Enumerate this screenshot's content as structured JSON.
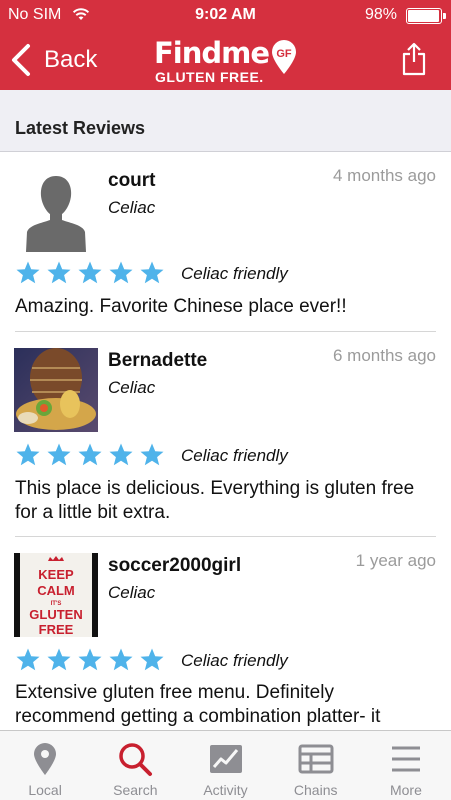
{
  "status_bar": {
    "carrier": "No SIM",
    "time": "9:02 AM",
    "battery": "98%",
    "battery_level": 0.98
  },
  "nav": {
    "back_label": "Back",
    "logo_top": "Findme",
    "logo_badge": "GF",
    "logo_bottom": "GLUTEN FREE."
  },
  "section": {
    "title": "Latest Reviews"
  },
  "reviews": [
    {
      "name": "court",
      "tag": "Celiac",
      "time_ago": "4 months ago",
      "rating": 5,
      "rating_label": "Celiac friendly",
      "text": "Amazing. Favorite Chinese place ever!!"
    },
    {
      "name": "Bernadette",
      "tag": "Celiac",
      "time_ago": "6 months ago",
      "rating": 5,
      "rating_label": "Celiac friendly",
      "text": "This place is delicious. Everything is gluten free for a little bit extra."
    },
    {
      "name": "soccer2000girl",
      "tag": "Celiac",
      "time_ago": "1 year ago",
      "rating": 5,
      "rating_label": "Celiac friendly",
      "text": "Extensive gluten free menu. Definitely recommend getting a combination platter- it"
    }
  ],
  "keep_calm": [
    "KEEP",
    "CALM",
    "IT'S",
    "GLUTEN",
    "FREE"
  ],
  "tabs": [
    {
      "label": "Local",
      "icon": "pin-icon",
      "active": false
    },
    {
      "label": "Search",
      "icon": "search-icon",
      "active": true
    },
    {
      "label": "Activity",
      "icon": "activity-icon",
      "active": false
    },
    {
      "label": "Chains",
      "icon": "chains-icon",
      "active": false
    },
    {
      "label": "More",
      "icon": "more-icon",
      "active": false
    }
  ],
  "colors": {
    "brand_red": "#d5303f",
    "star_blue": "#4fb3ea",
    "tab_active": "#c8202f",
    "tab_inactive": "#8e8e93"
  }
}
